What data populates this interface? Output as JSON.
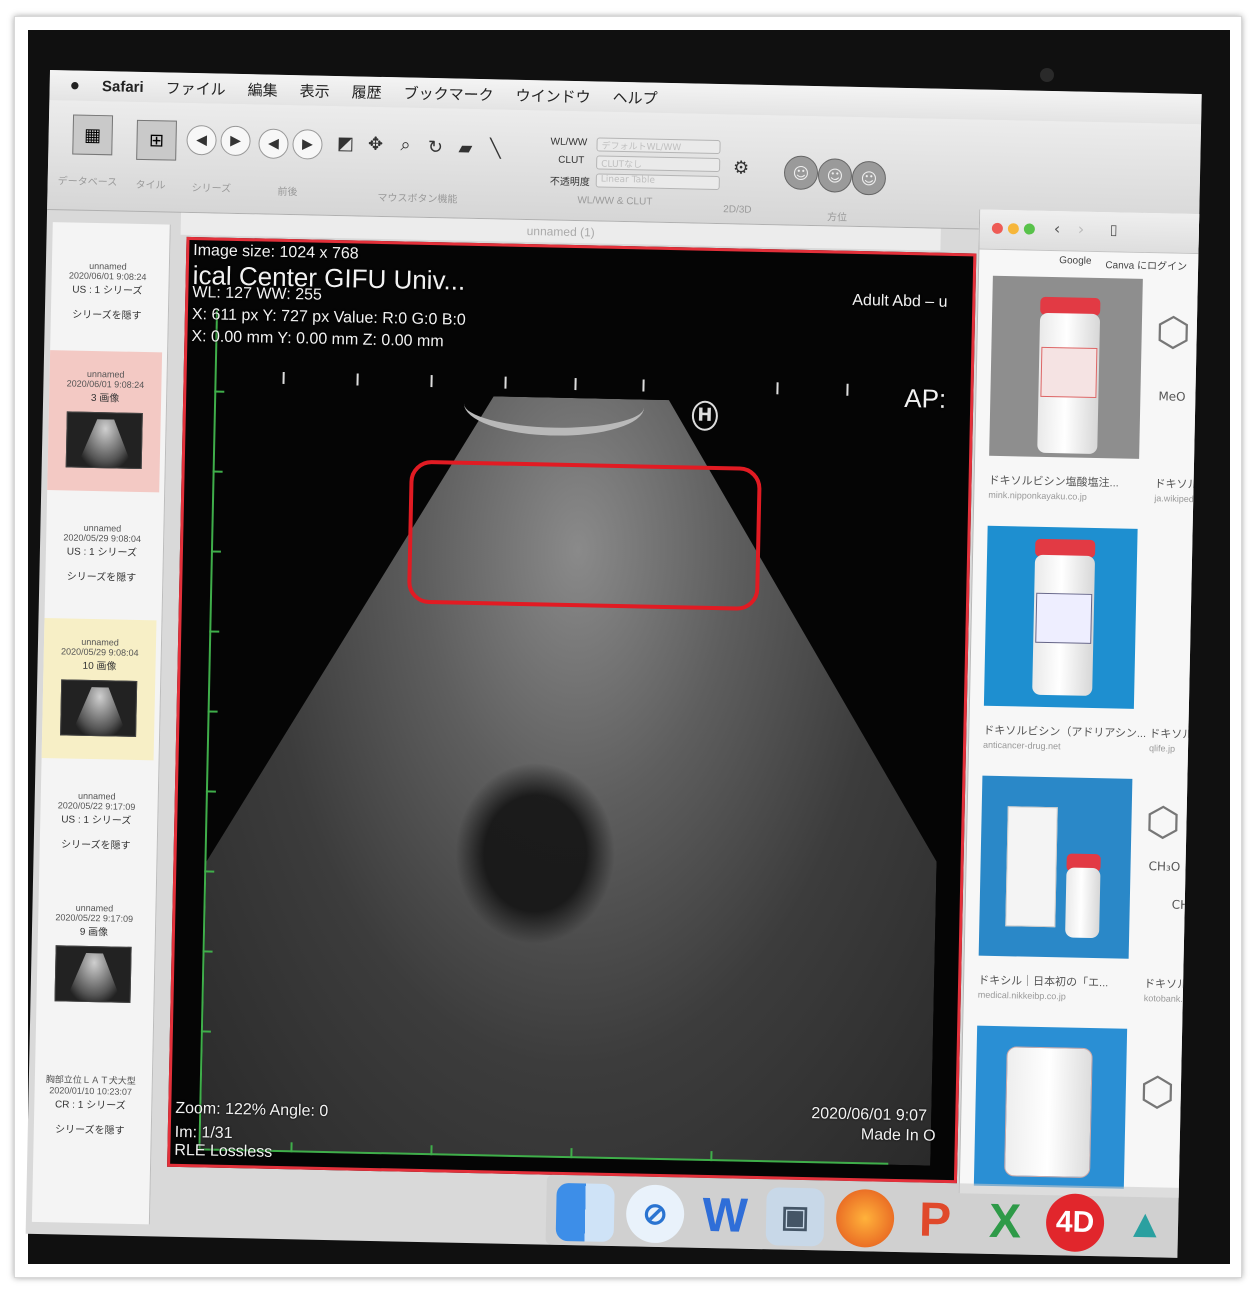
{
  "menubar": {
    "apple": "",
    "app": "Safari",
    "items": [
      "ファイル",
      "編集",
      "表示",
      "履歴",
      "ブックマーク",
      "ウインドウ",
      "ヘルプ"
    ]
  },
  "toolbar": {
    "labels": [
      "データベース",
      "タイル",
      "シリーズ",
      "前後",
      "マウスボタン機能",
      "WL/WW & CLUT",
      "2D/3D",
      "方位"
    ],
    "fields": [
      "WL/WW",
      "CLUT",
      "不透明度"
    ],
    "select_values": [
      "デフォルトWL/WW",
      "CLUTなし",
      "Linear Table"
    ]
  },
  "series": [
    {
      "name": "unnamed",
      "date": "2020/06/01 9:08:24",
      "info": "US : 1 シリーズ",
      "hide": "シリーズを隠す"
    },
    {
      "name": "unnamed",
      "date": "2020/06/01 9:08:24",
      "info": "3 画像"
    },
    {
      "name": "unnamed",
      "date": "2020/05/29 9:08:04",
      "info": "US : 1 シリーズ",
      "hide": "シリーズを隠す"
    },
    {
      "name": "unnamed",
      "date": "2020/05/29 9:08:04",
      "info": "10 画像"
    },
    {
      "name": "unnamed",
      "date": "2020/05/22 9:17:09",
      "info": "US : 1 シリーズ",
      "hide": "シリーズを隠す"
    },
    {
      "name": "unnamed",
      "date": "2020/05/22 9:17:09",
      "info": "9 画像"
    },
    {
      "name": "胸部立位ＬＡＴ犬大型",
      "date": "2020/01/10 10:23:07",
      "info": "CR : 1 シリーズ",
      "hide": "シリーズを隠す"
    }
  ],
  "viewer": {
    "title": "unnamed (1)",
    "image_size": "Image size: 1024 x 768",
    "institution": "ical Center GIFU Univ...",
    "wl_ww": "WL: 127 WW: 255",
    "px": "X: 611 px Y: 727 px Value: R:0 G:0 B:0",
    "mm": "X: 0.00 mm Y: 0.00 mm Z: 0.00 mm",
    "preset": "Adult Abd – u",
    "ap": "AP:",
    "h_marker": "H",
    "zoom": "Zoom: 122% Angle: 0",
    "im": "Im: 1/31",
    "compression": "RLE Lossless",
    "date": "2020/06/01 9:07",
    "made_in": "Made In O"
  },
  "safari": {
    "tabs": [
      "Google",
      "Canva にログイン"
    ],
    "results": [
      {
        "caption": "ドキソルビシン塩酸塩注...",
        "source": "mink.nipponkayaku.co.jp",
        "caption2": "ドキソルビシ",
        "source2": "ja.wikipedia.org"
      },
      {
        "caption": "ドキソルビシン（アドリアシン...",
        "source": "anticancer-drug.net",
        "caption2": "ドキソル",
        "source2": "qlife.jp"
      },
      {
        "caption": "ドキシル｜日本初の「エ...",
        "source": "medical.nikkeibp.co.jp",
        "caption2": "ドキソルビシン(",
        "source2": "kotobank.jp"
      },
      {
        "caption": "",
        "source": "",
        "caption2": "",
        "source2": ""
      }
    ],
    "molecule_labels": [
      "MeO",
      "CH₃O",
      "CH"
    ]
  },
  "dock": {
    "icons": [
      "finder-icon",
      "safari-icon",
      "word-icon",
      "preview-icon",
      "firefox-icon",
      "powerpoint-icon",
      "excel-icon",
      "osirix-4d-icon",
      "horos-icon"
    ],
    "letters": [
      "",
      "",
      "W",
      "",
      "",
      "P",
      "X",
      "4D",
      ""
    ]
  }
}
